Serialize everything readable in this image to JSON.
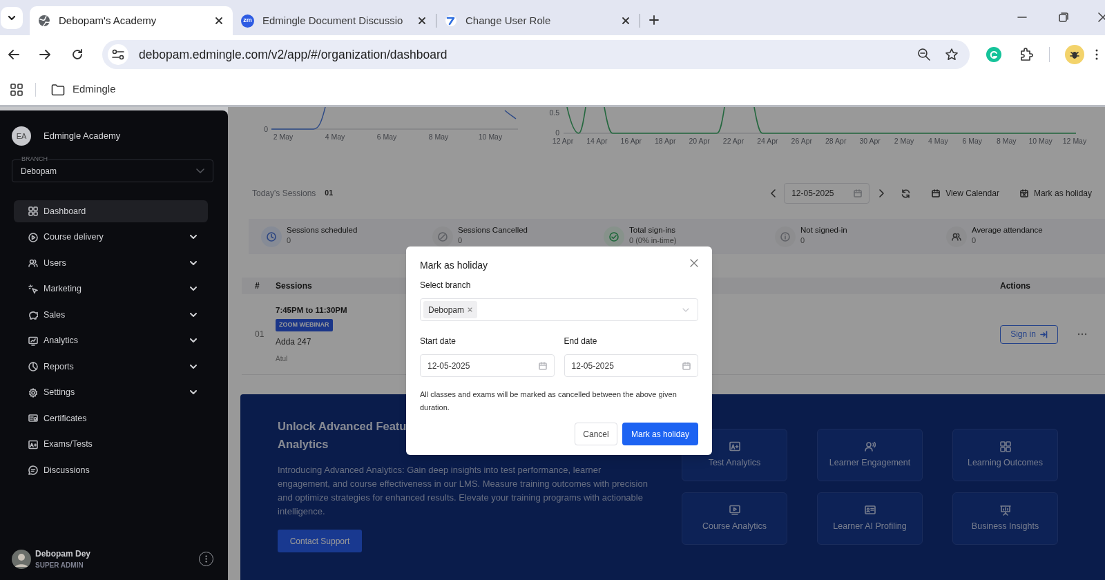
{
  "browser": {
    "tabs": [
      {
        "title": "Debopam's Academy",
        "selected": true
      },
      {
        "title": "Edmingle Document Discussio",
        "selected": false,
        "badge": "zm"
      },
      {
        "title": "Change User Role",
        "selected": false
      }
    ],
    "address": "debopam.edmingle.com/v2/app/#/organization/dashboard",
    "bookmarks": [
      {
        "label": "Edmingle"
      }
    ]
  },
  "sidebar": {
    "org": {
      "initials": "EA",
      "name": "Edmingle Academy"
    },
    "branch": {
      "label": "BRANCH",
      "value": "Debopam"
    },
    "items": [
      {
        "label": "Dashboard",
        "selected": true,
        "expandable": false
      },
      {
        "label": "Course delivery",
        "selected": false,
        "expandable": true
      },
      {
        "label": "Users",
        "selected": false,
        "expandable": true
      },
      {
        "label": "Marketing",
        "selected": false,
        "expandable": true
      },
      {
        "label": "Sales",
        "selected": false,
        "expandable": true
      },
      {
        "label": "Analytics",
        "selected": false,
        "expandable": true
      },
      {
        "label": "Reports",
        "selected": false,
        "expandable": true
      },
      {
        "label": "Settings",
        "selected": false,
        "expandable": true
      },
      {
        "label": "Certificates",
        "selected": false,
        "expandable": false
      },
      {
        "label": "Exams/Tests",
        "selected": false,
        "expandable": false
      },
      {
        "label": "Discussions",
        "selected": false,
        "expandable": false
      }
    ],
    "user": {
      "name": "Debopam Dey",
      "role": "SUPER ADMIN"
    }
  },
  "charts": {
    "left": {
      "yticks": [
        "0"
      ],
      "xticks": [
        "2 May",
        "4 May",
        "6 May",
        "8 May",
        "10 May"
      ]
    },
    "right": {
      "yticks": [
        "0.5",
        "0"
      ],
      "xticks": [
        "12 Apr",
        "14 Apr",
        "16 Apr",
        "18 Apr",
        "20 Apr",
        "22 Apr",
        "24 Apr",
        "26 Apr",
        "28 Apr",
        "30 Apr",
        "2 May",
        "4 May",
        "6 May",
        "8 May",
        "10 May",
        "12 May"
      ]
    }
  },
  "sessions": {
    "title": "Today's Sessions",
    "count": "01",
    "date": "12-05-2025",
    "actions": [
      {
        "label": "View Calendar"
      },
      {
        "label": "Mark as holiday"
      }
    ]
  },
  "stats": [
    {
      "label": "Sessions scheduled",
      "value": "0"
    },
    {
      "label": "Sessions Cancelled",
      "value": "0"
    },
    {
      "label": "Total sign-ins",
      "value": "0 (0% in-time)"
    },
    {
      "label": "Not signed-in",
      "value": "0"
    },
    {
      "label": "Average attendance",
      "value": "0"
    }
  ],
  "table": {
    "columns": [
      "#",
      "Sessions",
      "Actions"
    ],
    "rows": [
      {
        "index": "01",
        "time": "7:45PM to 11:30PM",
        "badge": "ZOOM WEBINAR",
        "title": "Adda 247",
        "host": "Atul",
        "action": "Sign in"
      }
    ]
  },
  "banner": {
    "title_lines": [
      "Unlock Advanced Featu",
      "Analytics"
    ],
    "description": "Introducing Advanced Analytics: Gain deep insights into test performance, learner engagement, and course effectiveness in our LMS. Measure training outcomes with precision and optimize strategies for enhanced results. Elevate your training programs with actionable intelligence.",
    "button": "Contact Support",
    "features": [
      {
        "label": "Test Analytics"
      },
      {
        "label": "Learner Engagement"
      },
      {
        "label": "Learning Outcomes"
      },
      {
        "label": "Course Analytics"
      },
      {
        "label": "Learner AI Profiling"
      },
      {
        "label": "Business Insights"
      }
    ]
  },
  "modal": {
    "title": "Mark as holiday",
    "branch_label": "Select branch",
    "branches": [
      {
        "label": "Debopam"
      }
    ],
    "start_label": "Start date",
    "start_value": "12-05-2025",
    "end_label": "End date",
    "end_value": "12-05-2025",
    "note": "All classes and exams will be marked as cancelled between the above given duration.",
    "cancel": "Cancel",
    "confirm": "Mark as holiday"
  }
}
